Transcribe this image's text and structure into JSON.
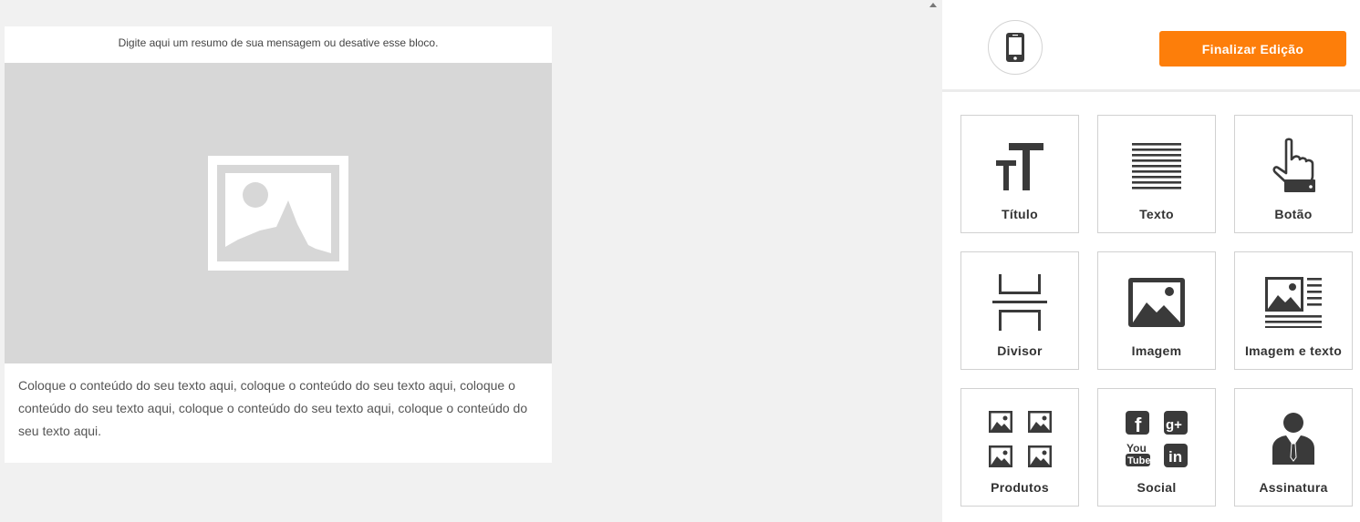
{
  "email": {
    "preheader": "Digite aqui um resumo de sua mensagem ou desative esse bloco.",
    "image_placeholder_icon": "image-placeholder-icon",
    "body_text": "Coloque o conteúdo do seu texto aqui, coloque o conteúdo do seu texto aqui, coloque o conteúdo do seu texto aqui, coloque o conteúdo do seu texto aqui, coloque o conteúdo do seu texto aqui."
  },
  "sidebar": {
    "mobile_preview_icon": "mobile-phone-icon",
    "finish_label": "Finalizar Edição",
    "blocks": [
      {
        "label": "Título",
        "icon": "title-icon"
      },
      {
        "label": "Texto",
        "icon": "text-lines-icon"
      },
      {
        "label": "Botão",
        "icon": "hand-pointer-icon"
      },
      {
        "label": "Divisor",
        "icon": "divider-icon"
      },
      {
        "label": "Imagem",
        "icon": "image-icon"
      },
      {
        "label": "Imagem e texto",
        "icon": "image-text-icon"
      },
      {
        "label": "Produtos",
        "icon": "products-grid-icon"
      },
      {
        "label": "Social",
        "icon": "social-icons-icon"
      },
      {
        "label": "Assinatura",
        "icon": "person-signature-icon"
      }
    ]
  },
  "colors": {
    "accent": "#fd7e0a",
    "canvas_bg": "#f1f1f1",
    "placeholder_bg": "#d7d7d7",
    "icon_dark": "#3a3a3a"
  }
}
